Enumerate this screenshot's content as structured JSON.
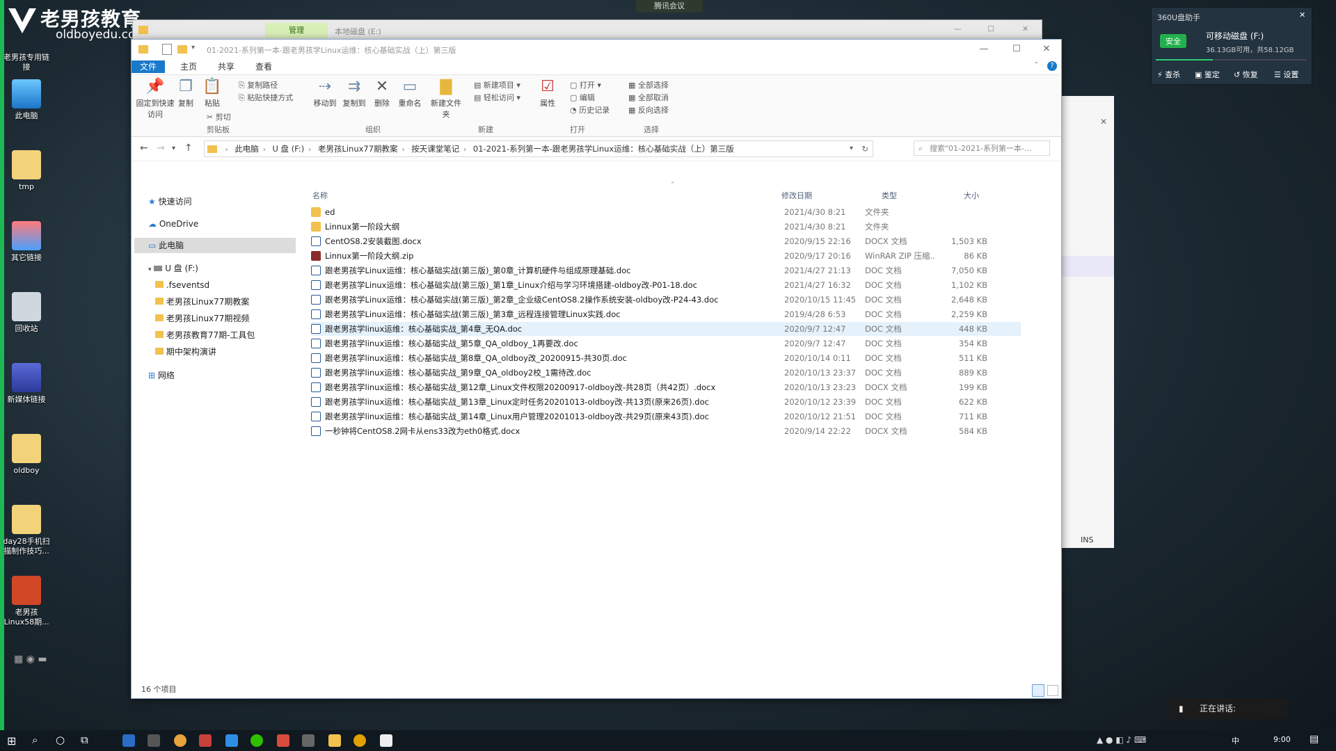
{
  "desktop": {
    "logo_text": "老男孩教育",
    "logo_url": "oldboyedu.com",
    "icons": [
      {
        "label": "老男孩专用链接"
      },
      {
        "label": "此电脑"
      },
      {
        "label": "tmp"
      },
      {
        "label": "其它链接"
      },
      {
        "label": "回收站"
      },
      {
        "label": "新媒体链接"
      },
      {
        "label": "oldboy"
      },
      {
        "label": "day28手机扫描制作技巧..."
      },
      {
        "label": "老男孩Linux58期..."
      }
    ]
  },
  "meeting_pill": "腾讯会议",
  "back_window": {
    "tab_label": "管理",
    "title": "本地磁盘 (E:)"
  },
  "explorer": {
    "title_path": "01-2021-系列第一本-跟老男孩学Linux运维：核心基础实战（上）第三版",
    "menu": {
      "file": "文件",
      "home": "主页",
      "share": "共享",
      "view": "查看"
    },
    "ribbon": {
      "pin": "固定到快速访问",
      "copy": "复制",
      "paste": "粘贴",
      "copy_path": "复制路径",
      "paste_shortcut": "粘贴快捷方式",
      "cut": "剪切",
      "clipboard": "剪贴板",
      "move_to": "移动到",
      "copy_to": "复制到",
      "delete": "删除",
      "rename": "重命名",
      "organize": "组织",
      "new_folder": "新建文件夹",
      "new_item": "新建项目",
      "easy_access": "轻松访问",
      "new": "新建",
      "properties": "属性",
      "open": "打开",
      "edit": "编辑",
      "history": "历史记录",
      "open_group": "打开",
      "select_all": "全部选择",
      "select_none": "全部取消",
      "invert": "反向选择",
      "select_group": "选择"
    },
    "breadcrumbs": [
      "此电脑",
      "U 盘 (F:)",
      "老男孩Linux77期教案",
      "按天课堂笔记",
      "01-2021-系列第一本-跟老男孩学Linux运维：核心基础实战（上）第三版"
    ],
    "search_placeholder": "搜索\"01-2021-系列第一本-...",
    "nav": {
      "quick": "快速访问",
      "onedrive": "OneDrive",
      "thispc": "此电脑",
      "udisk": "U 盘 (F:)",
      "sub": [
        ".fseventsd",
        "老男孩Linux77期教案",
        "老男孩Linux77期视频",
        "老男孩教育77期-工具包",
        "期中架构演讲"
      ],
      "network": "网络"
    },
    "columns": {
      "name": "名称",
      "date": "修改日期",
      "type": "类型",
      "size": "大小"
    },
    "files": [
      {
        "name": "ed",
        "date": "2021/4/30 8:21",
        "type": "文件夹",
        "size": "",
        "icon": "folder"
      },
      {
        "name": "Linnux第一阶段大纲",
        "date": "2021/4/30 8:21",
        "type": "文件夹",
        "size": "",
        "icon": "folder"
      },
      {
        "name": "CentOS8.2安装截图.docx",
        "date": "2020/9/15 22:16",
        "type": "DOCX 文档",
        "size": "1,503 KB",
        "icon": "doc"
      },
      {
        "name": "Linnux第一阶段大纲.zip",
        "date": "2020/9/17 20:16",
        "type": "WinRAR ZIP 压缩...",
        "size": "86 KB",
        "icon": "zip"
      },
      {
        "name": "跟老男孩学Linux运维：核心基础实战(第三版)_第0章_计算机硬件与组成原理基础.doc",
        "date": "2021/4/27 21:13",
        "type": "DOC 文档",
        "size": "7,050 KB",
        "icon": "doc"
      },
      {
        "name": "跟老男孩学Linux运维：核心基础实战(第三版)_第1章_Linux介绍与学习环境搭建-oldboy改-P01-18.doc",
        "date": "2021/4/27 16:32",
        "type": "DOC 文档",
        "size": "1,102 KB",
        "icon": "doc"
      },
      {
        "name": "跟老男孩学Linux运维：核心基础实战(第三版)_第2章_企业级CentOS8.2操作系统安装-oldboy改-P24-43.doc",
        "date": "2020/10/15 11:45",
        "type": "DOC 文档",
        "size": "2,648 KB",
        "icon": "doc"
      },
      {
        "name": "跟老男孩学Linux运维：核心基础实战(第三版)_第3章_远程连接管理Linux实践.doc",
        "date": "2019/4/28 6:53",
        "type": "DOC 文档",
        "size": "2,259 KB",
        "icon": "doc"
      },
      {
        "name": "跟老男孩学linux运维：核心基础实战_第4章_无QA.doc",
        "date": "2020/9/7 12:47",
        "type": "DOC 文档",
        "size": "448 KB",
        "icon": "doc"
      },
      {
        "name": "跟老男孩学linux运维：核心基础实战_第5章_QA_oldboy_1再要改.doc",
        "date": "2020/9/7 12:47",
        "type": "DOC 文档",
        "size": "354 KB",
        "icon": "doc"
      },
      {
        "name": "跟老男孩学linux运维：核心基础实战_第8章_QA_oldboy改_20200915-共30页.doc",
        "date": "2020/10/14 0:11",
        "type": "DOC 文档",
        "size": "511 KB",
        "icon": "doc"
      },
      {
        "name": "跟老男孩学linux运维：核心基础实战_第9章_QA_oldboy2校_1需待改.doc",
        "date": "2020/10/13 23:37",
        "type": "DOC 文档",
        "size": "889 KB",
        "icon": "doc"
      },
      {
        "name": "跟老男孩学linux运维：核心基础实战_第12章_Linux文件权限20200917-oldboy改-共28页（共42页）.docx",
        "date": "2020/10/13 23:23",
        "type": "DOCX 文档",
        "size": "199 KB",
        "icon": "doc"
      },
      {
        "name": "跟老男孩学linux运维：核心基础实战_第13章_Linux定时任务20201013-oldboy改-共13页(原来26页).doc",
        "date": "2020/10/12 23:39",
        "type": "DOC 文档",
        "size": "622 KB",
        "icon": "doc"
      },
      {
        "name": "跟老男孩学linux运维：核心基础实战_第14章_Linux用户管理20201013-oldboy改-共29页(原来43页).doc",
        "date": "2020/10/12 21:51",
        "type": "DOC 文档",
        "size": "711 KB",
        "icon": "doc"
      },
      {
        "name": "一秒钟将CentOS8.2网卡从ens33改为eth0格式.docx",
        "date": "2020/9/14 22:22",
        "type": "DOCX 文档",
        "size": "584 KB",
        "icon": "doc"
      }
    ],
    "status": "16 个项目"
  },
  "widget360": {
    "title": "360U盘助手",
    "badge": "安全",
    "drive": "可移动磁盘 (F:)",
    "space": "36.13GB可用，共58.12GB",
    "actions": [
      "查杀",
      "鉴定",
      "恢复",
      "设置"
    ]
  },
  "side_panel": {
    "ins": "INS"
  },
  "talk": "正在讲话:",
  "taskbar": {
    "ime": "中",
    "time": "9:00"
  },
  "colors": {
    "accent": "#1979ca",
    "folder": "#f2c14e",
    "doc": "#2b5797",
    "zip": "#8b2a2a",
    "green": "#1db954"
  }
}
